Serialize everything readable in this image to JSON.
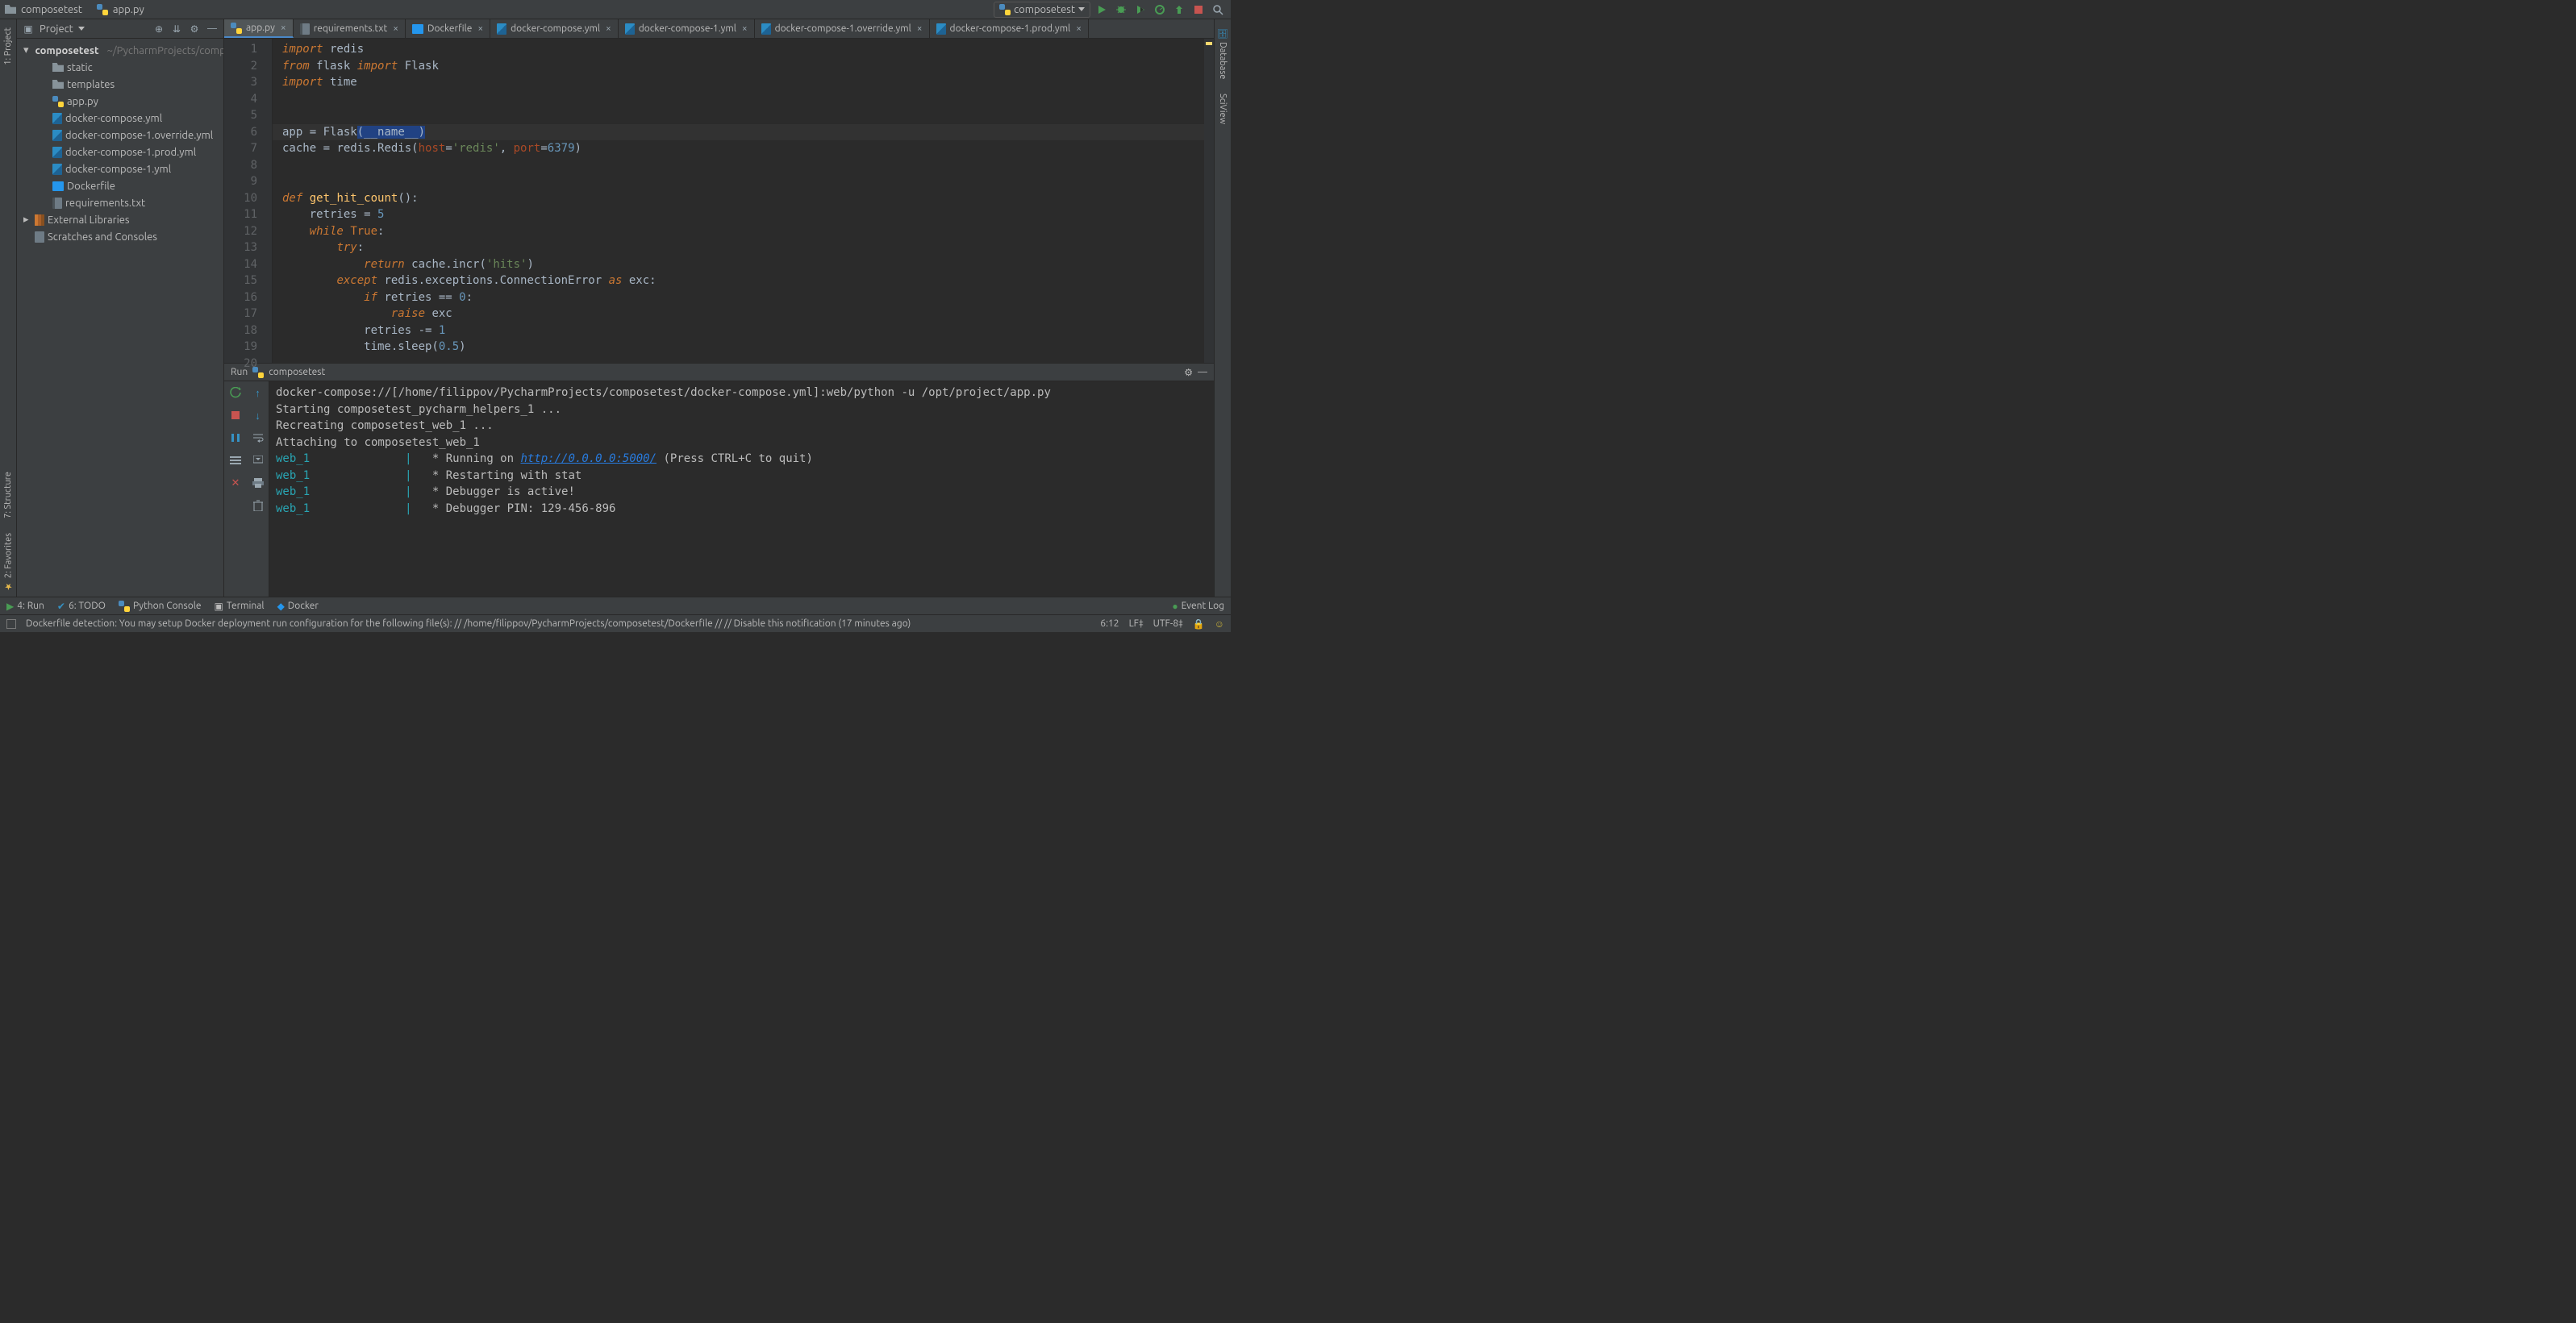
{
  "breadcrumb": {
    "project": "composetest",
    "file": "app.py"
  },
  "run_config": {
    "name": "composetest"
  },
  "project_view": {
    "label": "Project",
    "root": {
      "name": "composetest",
      "path": "~/PycharmProjects/composetest"
    },
    "folders": [
      "static",
      "templates"
    ],
    "files": [
      {
        "name": "app.py",
        "kind": "py"
      },
      {
        "name": "docker-compose.yml",
        "kind": "yml"
      },
      {
        "name": "docker-compose-1.override.yml",
        "kind": "yml"
      },
      {
        "name": "docker-compose-1.prod.yml",
        "kind": "yml"
      },
      {
        "name": "docker-compose-1.yml",
        "kind": "yml"
      },
      {
        "name": "Dockerfile",
        "kind": "docker"
      },
      {
        "name": "requirements.txt",
        "kind": "txt"
      }
    ],
    "extra": [
      "External Libraries",
      "Scratches and Consoles"
    ]
  },
  "tabs": [
    {
      "label": "app.py",
      "icon": "py",
      "active": true
    },
    {
      "label": "requirements.txt",
      "icon": "txt"
    },
    {
      "label": "Dockerfile",
      "icon": "docker"
    },
    {
      "label": "docker-compose.yml",
      "icon": "yml"
    },
    {
      "label": "docker-compose-1.yml",
      "icon": "yml"
    },
    {
      "label": "docker-compose-1.override.yml",
      "icon": "yml"
    },
    {
      "label": "docker-compose-1.prod.yml",
      "icon": "yml"
    }
  ],
  "editor": {
    "line_count": 20,
    "code_tokens": [
      [
        [
          "kw",
          "import"
        ],
        [
          "",
          " redis"
        ]
      ],
      [
        [
          "kw",
          "from"
        ],
        [
          "",
          " flask "
        ],
        [
          "kw",
          "import"
        ],
        [
          "",
          " Flask"
        ]
      ],
      [
        [
          "kw",
          "import"
        ],
        [
          "",
          " time"
        ]
      ],
      [],
      [],
      [
        [
          "",
          "app "
        ],
        [
          "op",
          "="
        ],
        [
          "",
          " Flask"
        ],
        [
          "sel",
          "("
        ],
        [
          "sel",
          "__name__"
        ],
        [
          "sel",
          ")"
        ]
      ],
      [
        [
          "",
          "cache "
        ],
        [
          "op",
          "="
        ],
        [
          "",
          " redis.Redis("
        ],
        [
          "arg",
          "host"
        ],
        [
          "op",
          "="
        ],
        [
          "str",
          "'redis'"
        ],
        [
          "op",
          ", "
        ],
        [
          "arg",
          "port"
        ],
        [
          "op",
          "="
        ],
        [
          "num",
          "6379"
        ],
        [
          "",
          ")"
        ]
      ],
      [],
      [],
      [
        [
          "kw",
          "def"
        ],
        [
          "",
          " "
        ],
        [
          "fn",
          "get_hit_count"
        ],
        [
          "",
          "():"
        ]
      ],
      [
        [
          "",
          "    retries "
        ],
        [
          "op",
          "="
        ],
        [
          "",
          " "
        ],
        [
          "num",
          "5"
        ]
      ],
      [
        [
          "",
          "    "
        ],
        [
          "kw",
          "while"
        ],
        [
          "",
          " "
        ],
        [
          "kw2",
          "True"
        ],
        [
          "",
          ":"
        ]
      ],
      [
        [
          "",
          "        "
        ],
        [
          "kw",
          "try"
        ],
        [
          "",
          ":"
        ]
      ],
      [
        [
          "",
          "            "
        ],
        [
          "kw",
          "return"
        ],
        [
          "",
          " cache.incr("
        ],
        [
          "str",
          "'hits'"
        ],
        [
          "",
          ")"
        ]
      ],
      [
        [
          "",
          "        "
        ],
        [
          "kw",
          "except"
        ],
        [
          "",
          " redis.exceptions.ConnectionError "
        ],
        [
          "kw",
          "as"
        ],
        [
          "",
          " exc:"
        ]
      ],
      [
        [
          "",
          "            "
        ],
        [
          "kw",
          "if"
        ],
        [
          "",
          " retries "
        ],
        [
          "op",
          "=="
        ],
        [
          "",
          " "
        ],
        [
          "num",
          "0"
        ],
        [
          "",
          ":"
        ]
      ],
      [
        [
          "",
          "                "
        ],
        [
          "kw",
          "raise"
        ],
        [
          "",
          " exc"
        ]
      ],
      [
        [
          "",
          "            retries "
        ],
        [
          "op",
          "-="
        ],
        [
          "",
          " "
        ],
        [
          "num",
          "1"
        ]
      ],
      [
        [
          "",
          "            time.sleep("
        ],
        [
          "num",
          "0.5"
        ],
        [
          "",
          ")"
        ]
      ],
      []
    ],
    "current_line": 6
  },
  "left_rail": {
    "project": "1: Project",
    "structure": "7: Structure",
    "favorites": "2: Favorites"
  },
  "right_rail": {
    "database": "Database",
    "sciview": "SciView"
  },
  "run": {
    "tab_label": "Run",
    "config": "composetest",
    "lines": [
      {
        "pre": "",
        "txt": "docker-compose://[/home/filippov/PycharmProjects/composetest/docker-compose.yml]:web/python -u /opt/project/app.py"
      },
      {
        "pre": "",
        "txt": "Starting composetest_pycharm_helpers_1 ..."
      },
      {
        "pre": "",
        "txt": "Recreating composetest_web_1 ..."
      },
      {
        "pre": "",
        "txt": "Attaching to composetest_web_1"
      },
      {
        "pre": "web_1",
        "sep": "|",
        "txt": " * Running on ",
        "link": "http://0.0.0.0:5000/",
        "after": " (Press CTRL+C to quit)"
      },
      {
        "pre": "web_1",
        "sep": "|",
        "txt": " * Restarting with stat"
      },
      {
        "pre": "web_1",
        "sep": "|",
        "txt": " * Debugger is active!"
      },
      {
        "pre": "web_1",
        "sep": "|",
        "txt": " * Debugger PIN: 129-456-896"
      }
    ]
  },
  "toolwindows": {
    "run": "4: Run",
    "todo": "6: TODO",
    "pyconsole": "Python Console",
    "terminal": "Terminal",
    "docker": "Docker",
    "eventlog": "Event Log"
  },
  "status": {
    "message": "Dockerfile detection: You may setup Docker deployment run configuration for the following file(s): // /home/filippov/PycharmProjects/composetest/Dockerfile // // Disable this notification (17 minutes ago)",
    "caret": "6:12",
    "lf": "LF",
    "encoding": "UTF-8"
  }
}
